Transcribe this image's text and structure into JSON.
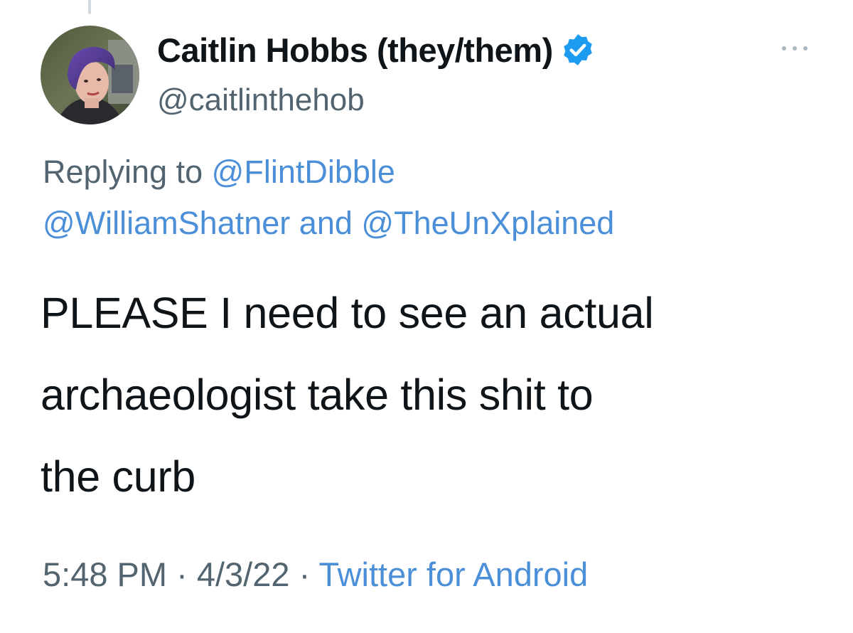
{
  "author": {
    "display_name": "Caitlin Hobbs (they/them)",
    "handle": "@caitlinthehob",
    "verified": true,
    "avatar_icon": "profile-photo"
  },
  "reply": {
    "prefix": "Replying to",
    "mention_1": "@FlintDibble",
    "mention_2": "@WilliamShatner",
    "connector": "and",
    "mention_3": "@TheUnXplained"
  },
  "tweet": {
    "line_1": "PLEASE I need to see an actual",
    "line_2": "archaeologist take this shit to",
    "line_3": "the curb"
  },
  "meta": {
    "time": "5:48 PM",
    "separator": "·",
    "date": "4/3/22",
    "source": "Twitter for Android"
  },
  "icons": {
    "verified": "verified-badge-icon",
    "more": "more-options-icon"
  },
  "colors": {
    "text": "#0f1419",
    "secondary": "#536471",
    "link": "#4b8fd8",
    "verified": "#1d9bf0"
  }
}
